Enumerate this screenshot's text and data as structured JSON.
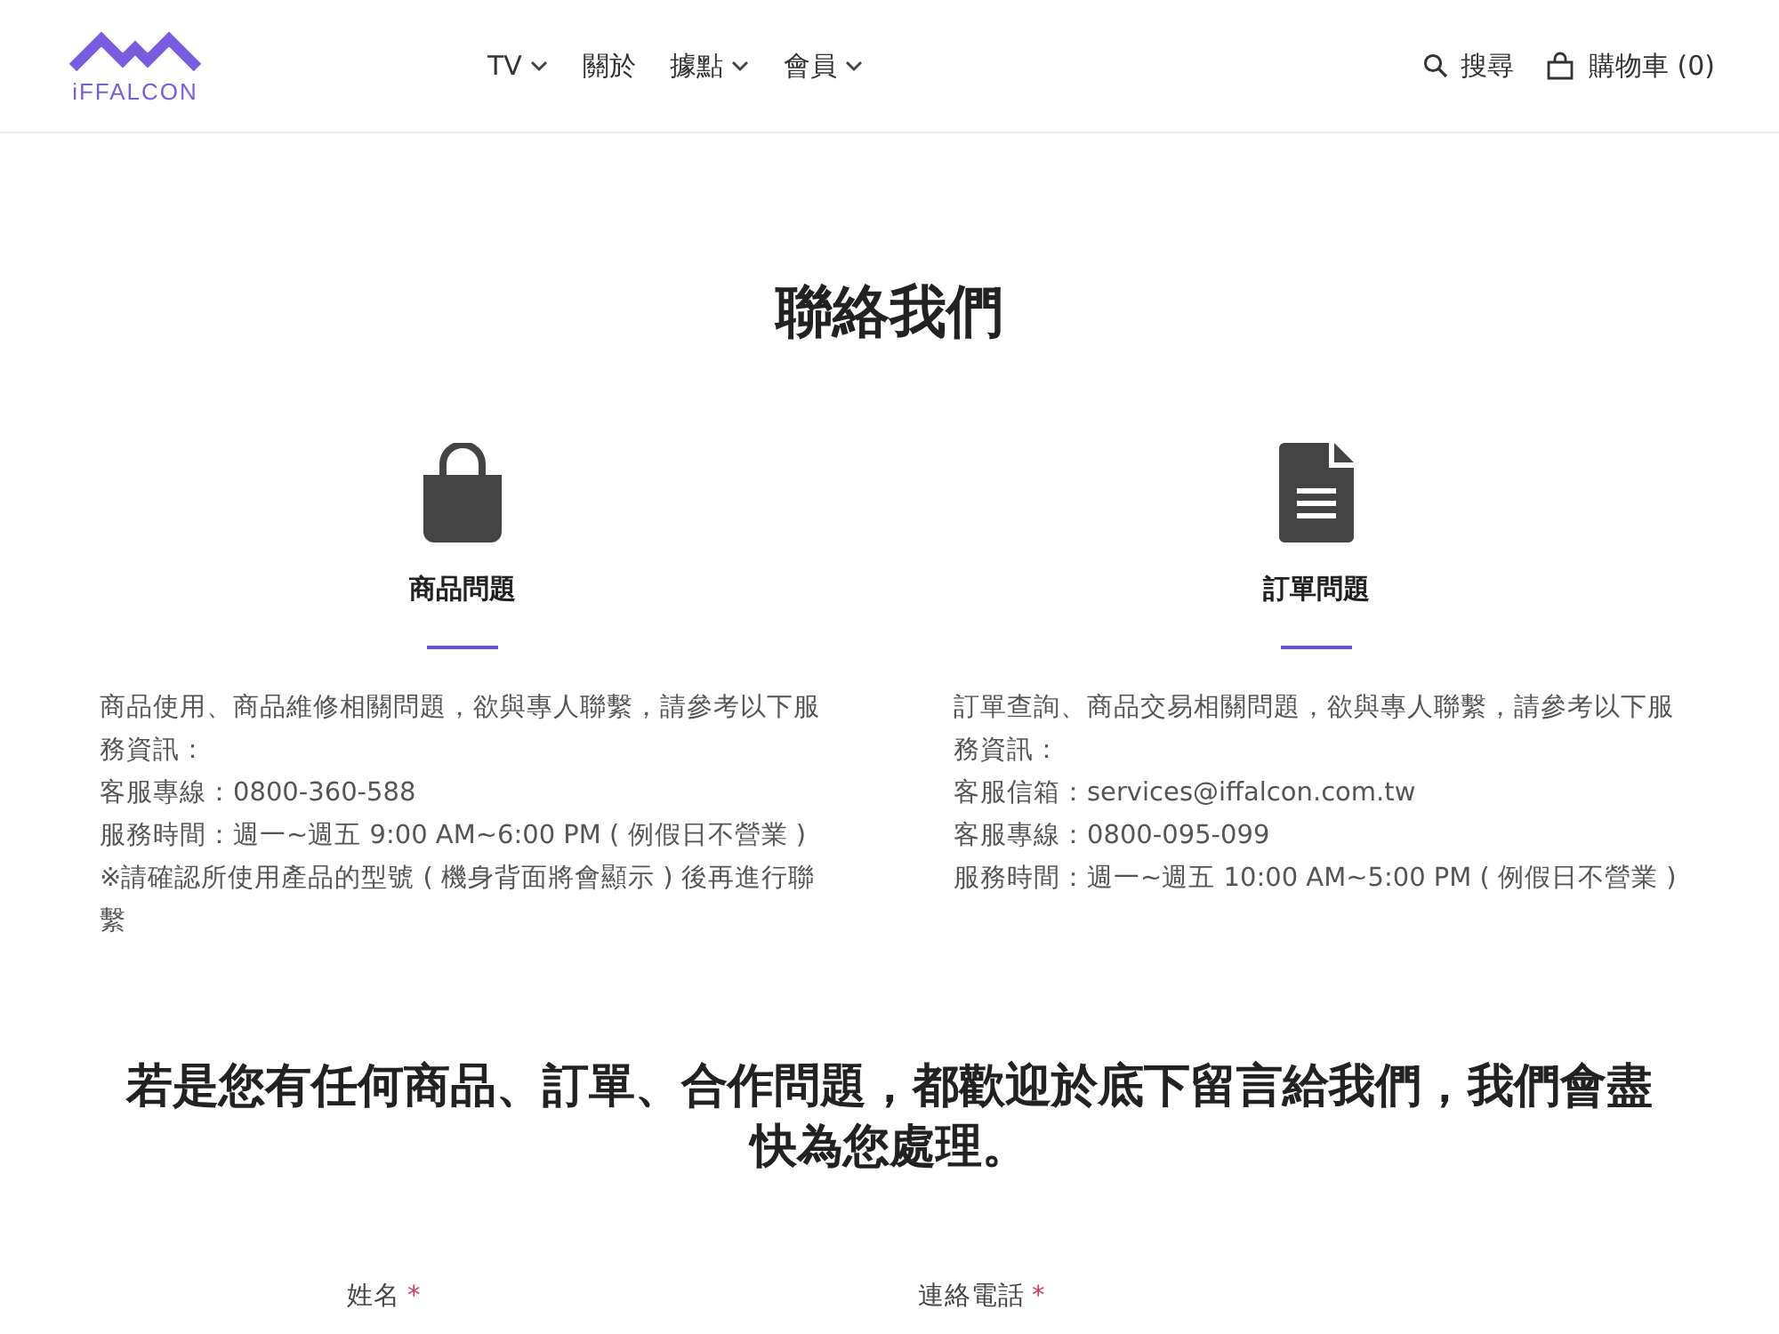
{
  "header": {
    "logo_text": "iFFALCON",
    "nav": [
      {
        "label": "TV",
        "dropdown": true
      },
      {
        "label": "關於",
        "dropdown": false
      },
      {
        "label": "據點",
        "dropdown": true
      },
      {
        "label": "會員",
        "dropdown": true
      }
    ],
    "search_label": "搜尋",
    "cart_label": "購物車 (0)"
  },
  "page_title": "聯絡我們",
  "cards": [
    {
      "kind": "bag",
      "title": "商品問題",
      "lines": [
        "商品使用、商品維修相關問題，欲與專人聯繫，請參考以下服務資訊：",
        "客服專線：0800-360-588",
        "服務時間：週一~週五 9:00 AM~6:00 PM ( 例假日不營業 )",
        "※請確認所使用產品的型號 ( 機身背面將會顯示 ) 後再進行聯繫"
      ]
    },
    {
      "kind": "document",
      "title": "訂單問題",
      "lines": [
        "訂單查詢、商品交易相關問題，欲與專人聯繫，請參考以下服務資訊：",
        "客服信箱：services@iffalcon.com.tw",
        "客服專線：0800-095-099",
        "服務時間：週一~週五 10:00 AM~5:00 PM ( 例假日不營業 )"
      ]
    }
  ],
  "form_heading": "若是您有任何商品、訂單、合作問題，都歡迎於底下留言給我們，我們會盡快為您處理。",
  "form_fields": [
    {
      "label": "姓名",
      "required": true,
      "required_mark": "*"
    },
    {
      "label": "連絡電話",
      "required": true,
      "required_mark": "*"
    }
  ]
}
